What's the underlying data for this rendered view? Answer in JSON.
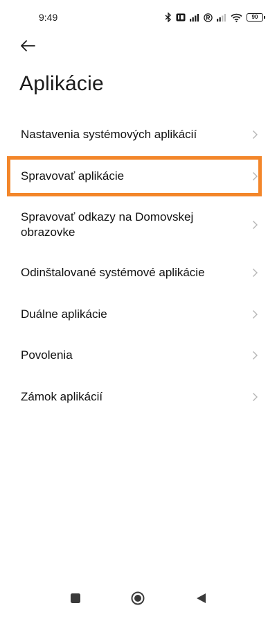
{
  "status_bar": {
    "time": "9:49",
    "battery_level": "90",
    "icons": [
      "bluetooth-icon",
      "hd-signal-icon",
      "signal-icon",
      "registered-icon",
      "signal-icon",
      "wifi-icon",
      "battery-icon"
    ]
  },
  "header": {
    "back_icon": "arrow-left-icon",
    "title": "Aplikácie"
  },
  "menu": {
    "items": [
      {
        "label": "Nastavenia systémových aplikácií"
      },
      {
        "label": "Spravovať aplikácie"
      },
      {
        "label": "Spravovať odkazy na Domovskej obrazovke"
      },
      {
        "label": "Odinštalované systémové aplikácie"
      },
      {
        "label": "Duálne aplikácie"
      },
      {
        "label": "Povolenia"
      },
      {
        "label": "Zámok aplikácií"
      }
    ],
    "highlighted_item": "Spravovať aplikácie"
  },
  "nav_bar": {
    "buttons": [
      "square-recents-icon",
      "circle-home-icon",
      "triangle-back-icon"
    ]
  },
  "colors": {
    "highlight": "#f3862a",
    "text": "#111111",
    "chevron": "#b5b5b5"
  }
}
